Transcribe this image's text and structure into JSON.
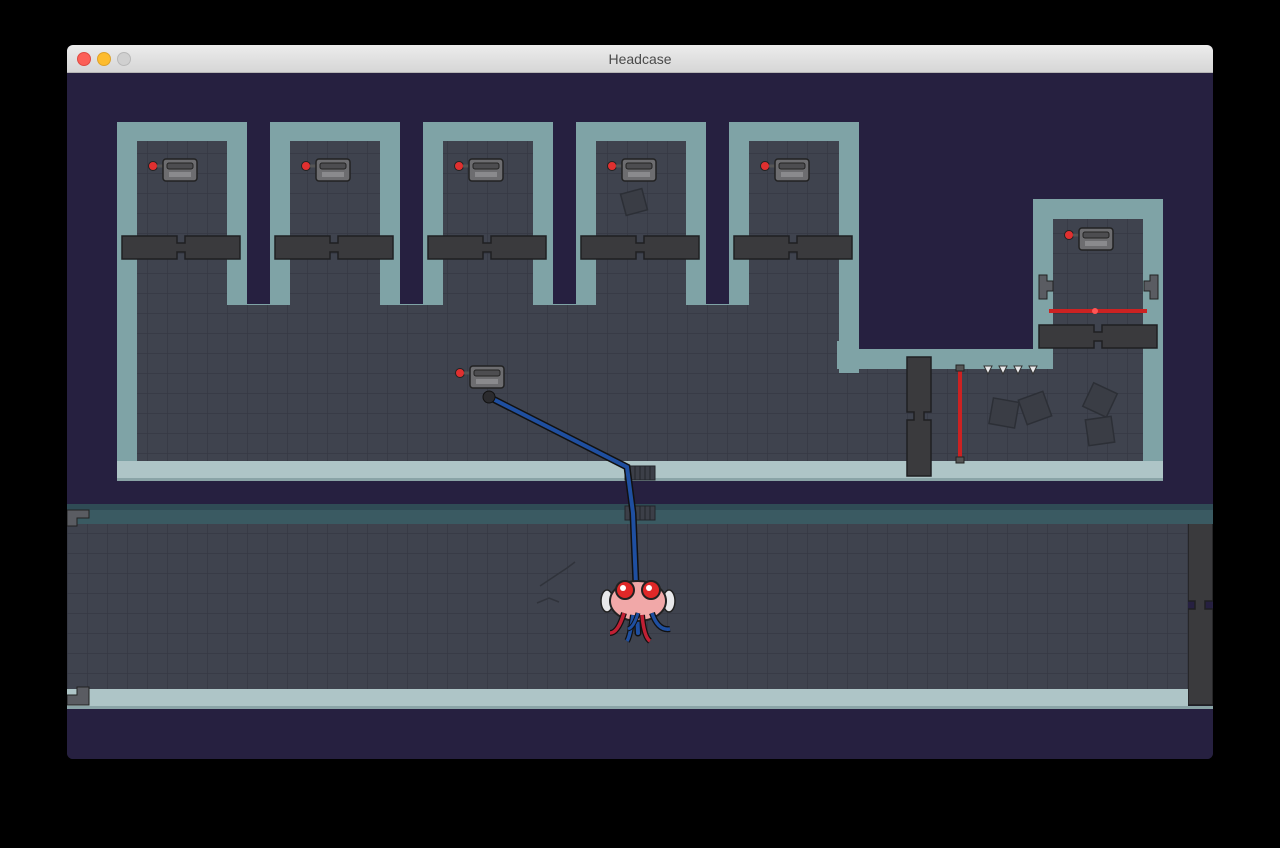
{
  "window": {
    "title": "Headcase",
    "buttons": [
      "close",
      "minimize",
      "zoom"
    ]
  },
  "colors": {
    "void": "#262040",
    "floor": "#3f434e",
    "wall": "#7fa3a6",
    "laser": "#cc2222",
    "cable": "#1f4fa0",
    "button_red": "#e03030"
  },
  "scene": {
    "cells": 5,
    "side_room": true,
    "switches": 7,
    "lasers": 2,
    "spikes": 4,
    "player": "brain-creature"
  }
}
